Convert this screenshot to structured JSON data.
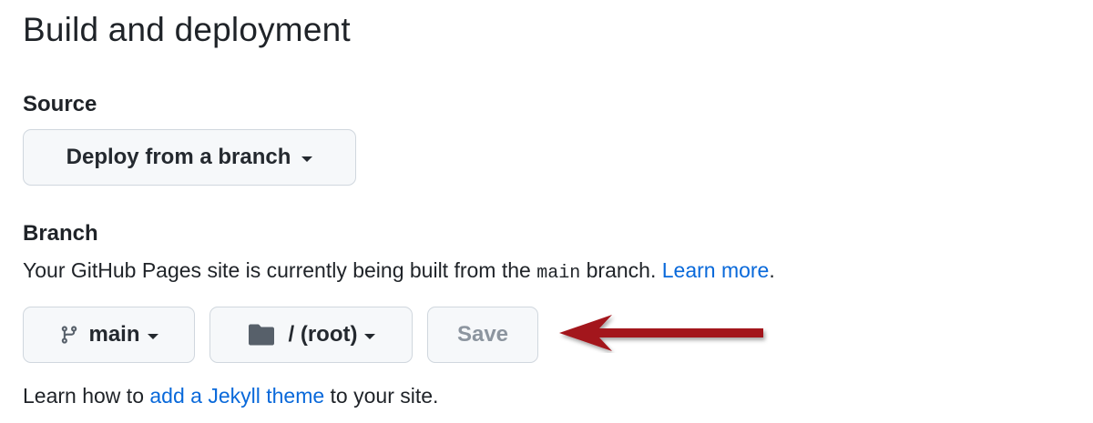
{
  "header": {
    "title": "Build and deployment"
  },
  "source": {
    "label": "Source",
    "dropdown_value": "Deploy from a branch"
  },
  "branch": {
    "label": "Branch",
    "description_prefix": "Your GitHub Pages site is currently being built from the ",
    "branch_code": "main",
    "description_suffix": " branch. ",
    "learn_more": "Learn more",
    "period": ".",
    "branch_select": "main",
    "folder_select": "/ (root)",
    "save_label": "Save"
  },
  "footer": {
    "prefix": "Learn how to ",
    "link": "add a Jekyll theme",
    "suffix": " to your site."
  },
  "colors": {
    "link": "#0969da",
    "button_bg": "#f6f8fa",
    "button_border": "#d0d7de",
    "disabled_text": "#8c959f",
    "arrow": "#a3151c"
  },
  "icons": {
    "branch": "git-branch-icon",
    "folder": "folder-icon",
    "caret": "caret-down-icon",
    "annotation": "red-arrow-annotation"
  }
}
